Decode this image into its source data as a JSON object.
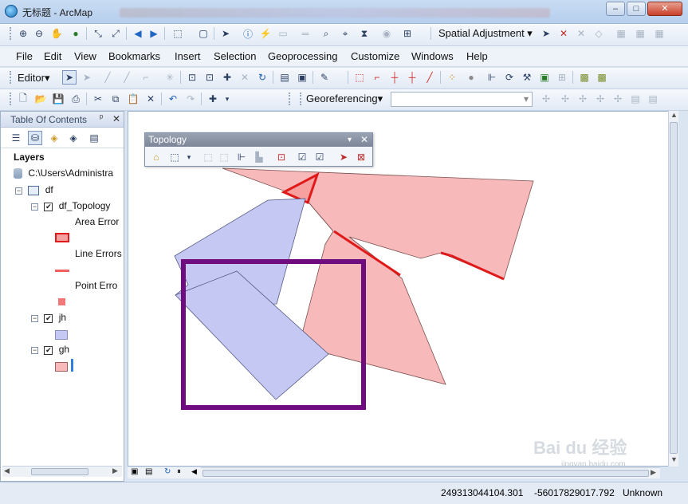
{
  "window": {
    "title": "无标题 - ArcMap",
    "buttons": [
      "–",
      "□",
      "✕"
    ]
  },
  "toolbar1": {
    "spatial_adjustment_label": "Spatial Adjustment",
    "icons": [
      "zoom-in-icon",
      "zoom-out-icon",
      "pan-icon",
      "globe-icon",
      "fixed-zoom-in-icon",
      "fixed-zoom-out-icon",
      "back-icon",
      "forward-icon",
      "select-features-icon",
      "clear-selection-icon",
      "select-elements-icon",
      "identify-icon",
      "hyperlink-icon",
      "html-popup-icon",
      "measure-icon",
      "find-icon",
      "go-to-xy-icon",
      "time-slider-icon",
      "create-viewer-window-icon",
      "add-data-icon"
    ]
  },
  "menubar": {
    "items": [
      "File",
      "Edit",
      "View",
      "Bookmarks",
      "Insert",
      "Selection",
      "Geoprocessing",
      "Customize",
      "Windows",
      "Help"
    ]
  },
  "toolbar2": {
    "editor_label": "Editor"
  },
  "toolbar3": {
    "georef_label": "Georeferencing",
    "layer_dropdown_value": ""
  },
  "toc": {
    "title": "Table Of Contents",
    "pin": "ᵖ",
    "close": "✕",
    "layers_label": "Layers",
    "path": "C:\\Users\\Administra",
    "df": "df",
    "topology": "df_Topology",
    "area_errors": "Area Error",
    "line_errors": "Line Errors",
    "point_errors": "Point Erro",
    "jh": "jh",
    "gh": "gh"
  },
  "topology_toolbar": {
    "title": "Topology"
  },
  "status": {
    "x": "249313044104.301",
    "y": "-56017829017.792",
    "units": "Unknown"
  },
  "watermark": {
    "text": "Bai du 经验",
    "sub": "jingyan.baidu.com"
  },
  "colors": {
    "blue_fill": "#c4c8f3",
    "pink_fill": "#f7b9b9",
    "error_red": "#e01a1a",
    "frame_purple": "#6f0d80"
  }
}
